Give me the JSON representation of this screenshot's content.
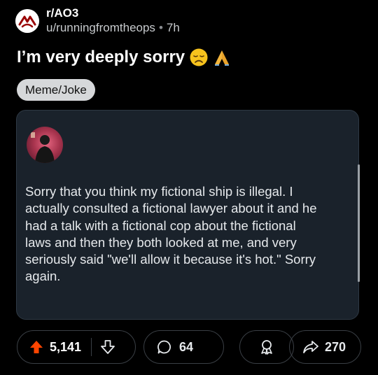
{
  "post": {
    "subreddit": "r/AO3",
    "username": "u/runningfromtheops",
    "separator": "•",
    "age": "7h",
    "title": "I’m very deeply sorry",
    "title_emoji": [
      "disappointed-face-emoji",
      "folded-hands-emoji"
    ],
    "flair": "Meme/Joke"
  },
  "embedded": {
    "text": "Sorry that you think my fictional ship is illegal. I\nactually consulted a fictional lawyer about it and he\nhad a talk with a fictional cop about the fictional\nlaws and then they both looked at me, and very\nseriously said \"we'll allow it because it's hot.\" Sorry\nagain."
  },
  "actions": {
    "upvotes": "5,141",
    "comments": "64",
    "shares": "270"
  },
  "colors": {
    "background": "#000000",
    "upvote": "#ff4500",
    "card": "#1a222b",
    "flair": "#d6d8da"
  }
}
